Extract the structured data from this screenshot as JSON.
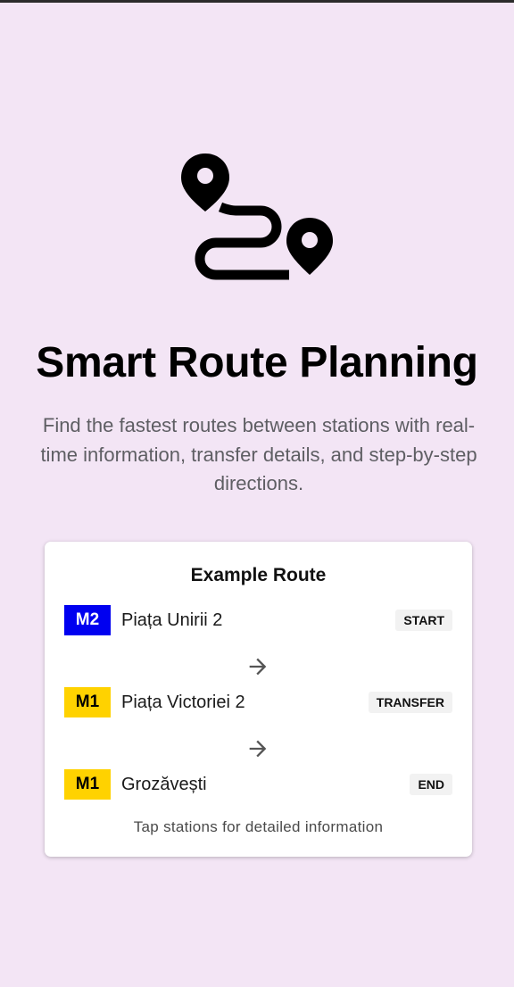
{
  "hero": {
    "icon": "route-icon",
    "title": "Smart Route Planning",
    "subtitle": "Find the fastest routes between stations with real-time information, transfer details, and step-by-step directions."
  },
  "example": {
    "title": "Example Route",
    "stops": [
      {
        "line": "M2",
        "line_color": "#0000f0",
        "line_text_color": "#ffffff",
        "station": "Piața Unirii 2",
        "role": "START"
      },
      {
        "line": "M1",
        "line_color": "#ffd200",
        "line_text_color": "#000000",
        "station": "Piața Victoriei 2",
        "role": "TRANSFER"
      },
      {
        "line": "M1",
        "line_color": "#ffd200",
        "line_text_color": "#000000",
        "station": "Grozăvești",
        "role": "END"
      }
    ],
    "arrow_icon": "arrow-right-icon",
    "footer": "Tap stations for detailed information"
  },
  "colors": {
    "background": "#f3e5f5",
    "card": "#ffffff",
    "subtitle": "#5e5e63"
  }
}
